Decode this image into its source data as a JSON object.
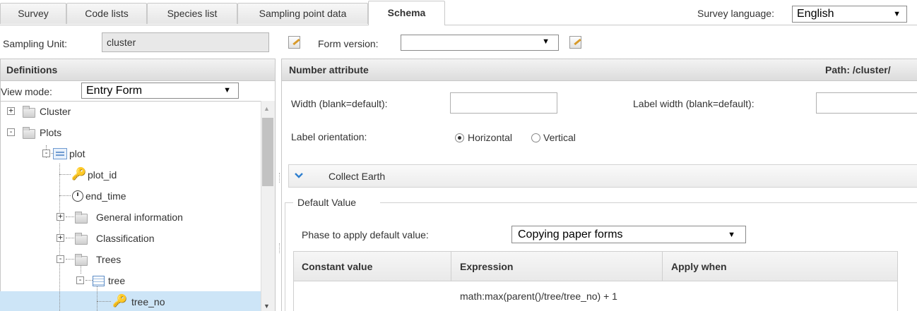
{
  "tabs": [
    {
      "label": "Survey",
      "active": false
    },
    {
      "label": "Code lists",
      "active": false
    },
    {
      "label": "Species list",
      "active": false
    },
    {
      "label": "Sampling point data",
      "active": false
    },
    {
      "label": "Schema",
      "active": true
    }
  ],
  "survey_language": {
    "label": "Survey language:",
    "value": "English"
  },
  "sampling_unit": {
    "label": "Sampling Unit:",
    "value": "cluster"
  },
  "form_version": {
    "label": "Form version:",
    "value": ""
  },
  "definitions": {
    "title": "Definitions",
    "view_mode_label": "View mode:",
    "view_mode_value": "Entry Form",
    "tree": [
      {
        "label": "Cluster",
        "icon": "folder-icon",
        "expander": "+"
      },
      {
        "label": "Plots",
        "icon": "folder-icon",
        "expander": "-"
      },
      {
        "label": "plot",
        "icon": "entity-icon",
        "expander": "-"
      },
      {
        "label": "plot_id",
        "icon": "key-icon"
      },
      {
        "label": "end_time",
        "icon": "clock-icon"
      },
      {
        "label": "General information",
        "icon": "folder-icon",
        "expander": "+"
      },
      {
        "label": "Classification",
        "icon": "folder-icon",
        "expander": "+"
      },
      {
        "label": "Trees",
        "icon": "folder-icon",
        "expander": "-"
      },
      {
        "label": "tree",
        "icon": "table-icon",
        "expander": "-"
      },
      {
        "label": "tree_no",
        "icon": "key-icon",
        "selected": true
      }
    ]
  },
  "detail": {
    "title": "Number attribute",
    "path": "Path: /cluster/",
    "width_label": "Width (blank=default):",
    "width_value": "",
    "label_width_label": "Label width (blank=default):",
    "label_width_value": "",
    "orientation_label": "Label orientation:",
    "orientation_options": [
      "Horizontal",
      "Vertical"
    ],
    "orientation_selected": "Horizontal",
    "collect_earth": "Collect Earth",
    "default_value_legend": "Default Value",
    "phase_label": "Phase to apply default value:",
    "phase_value": "Copying paper forms",
    "grid": {
      "columns": [
        "Constant value",
        "Expression",
        "Apply when"
      ],
      "rows": [
        [
          "",
          "math:max(parent()/tree/tree_no) + 1",
          ""
        ]
      ]
    }
  }
}
